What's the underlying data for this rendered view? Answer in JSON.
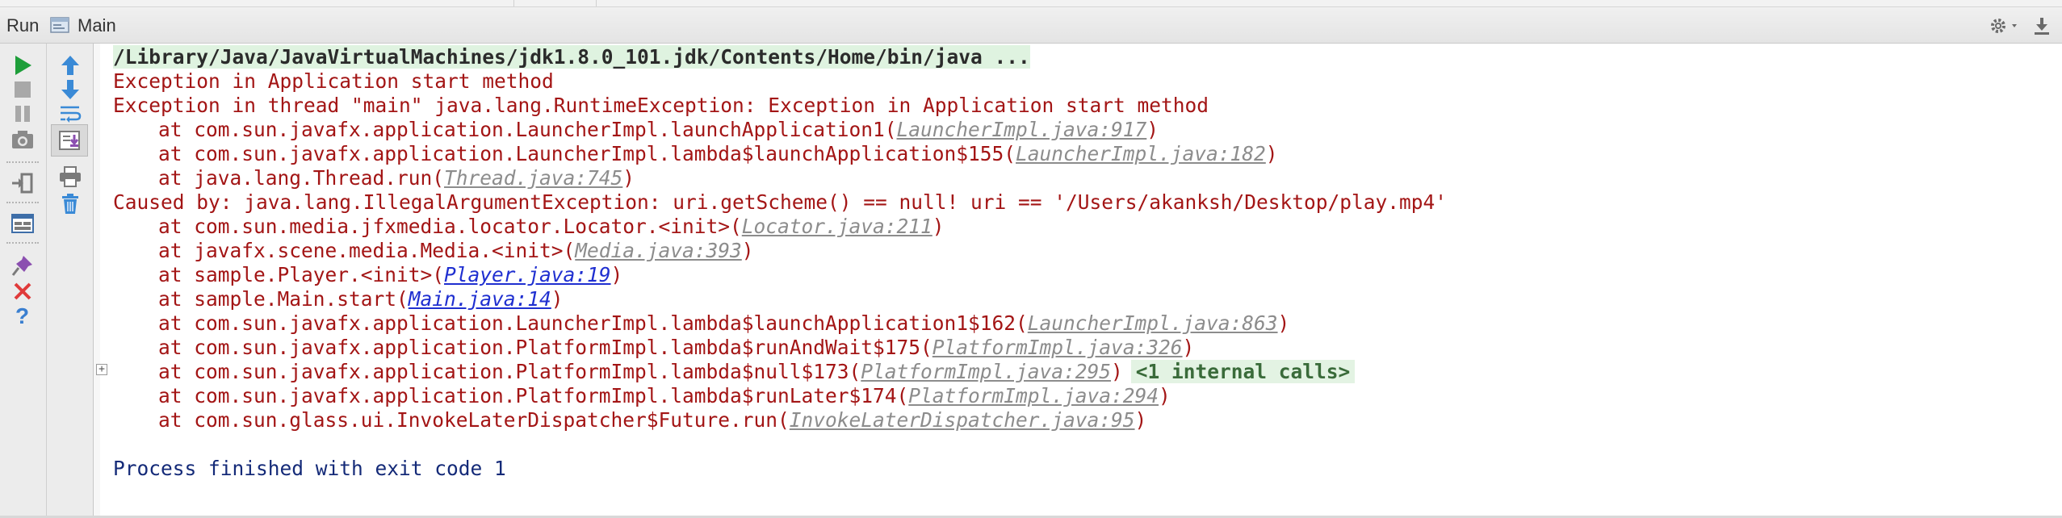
{
  "header": {
    "run_label": "Run",
    "config_name": "Main",
    "icons": [
      "main-config-icon",
      "gear-icon",
      "pin-icon"
    ]
  },
  "toolbar_left": {
    "icons": [
      "run-icon",
      "stop-icon",
      "pause-icon",
      "dump-threads-icon",
      "login-icon",
      "restore-layout-icon",
      "pin-tab-icon",
      "close-icon",
      "help-icon"
    ]
  },
  "toolbar_right": {
    "icons": [
      "up-arrow-icon",
      "down-arrow-icon",
      "soft-wrap-icon",
      "scroll-to-end-icon",
      "print-icon",
      "trash-icon"
    ]
  },
  "console": {
    "command_line": "/Library/Java/JavaVirtualMachines/jdk1.8.0_101.jdk/Contents/Home/bin/java ...",
    "lines": {
      "l1": "Exception in Application start method",
      "l2": "Exception in thread \"main\" java.lang.RuntimeException: Exception in Application start method",
      "s1_pre": "at com.sun.javafx.application.LauncherImpl.launchApplication1(",
      "s1_link": "LauncherImpl.java:917",
      "s2_pre": "at com.sun.javafx.application.LauncherImpl.lambda$launchApplication$155(",
      "s2_link": "LauncherImpl.java:182",
      "s3_pre": "at java.lang.Thread.run(",
      "s3_link": "Thread.java:745",
      "caused": "Caused by: java.lang.IllegalArgumentException: uri.getScheme() == null! uri == '/Users/akanksh/Desktop/play.mp4'",
      "s4_pre": "at com.sun.media.jfxmedia.locator.Locator.<init>(",
      "s4_link": "Locator.java:211",
      "s5_pre": "at javafx.scene.media.Media.<init>(",
      "s5_link": "Media.java:393",
      "s6_pre": "at sample.Player.<init>(",
      "s6_link": "Player.java:19",
      "s7_pre": "at sample.Main.start(",
      "s7_link": "Main.java:14",
      "s8_pre": "at com.sun.javafx.application.LauncherImpl.lambda$launchApplication1$162(",
      "s8_link": "LauncherImpl.java:863",
      "s9_pre": "at com.sun.javafx.application.PlatformImpl.lambda$runAndWait$175(",
      "s9_link": "PlatformImpl.java:326",
      "s10_pre": "at com.sun.javafx.application.PlatformImpl.lambda$null$173(",
      "s10_link": "PlatformImpl.java:295",
      "s10_internal": "<1 internal calls>",
      "s11_pre": "at com.sun.javafx.application.PlatformImpl.lambda$runLater$174(",
      "s11_link": "PlatformImpl.java:294",
      "s12_pre": "at com.sun.glass.ui.InvokeLaterDispatcher$Future.run(",
      "s12_link": "InvokeLaterDispatcher.java:95",
      "close": ")",
      "exit": "Process finished with exit code 1"
    }
  },
  "colors": {
    "error_text": "#a31515",
    "link_gray": "#8c8c8c",
    "link_blue": "#1f2fd0",
    "exit_text": "#142a78",
    "run_green": "#1e9e3a"
  }
}
